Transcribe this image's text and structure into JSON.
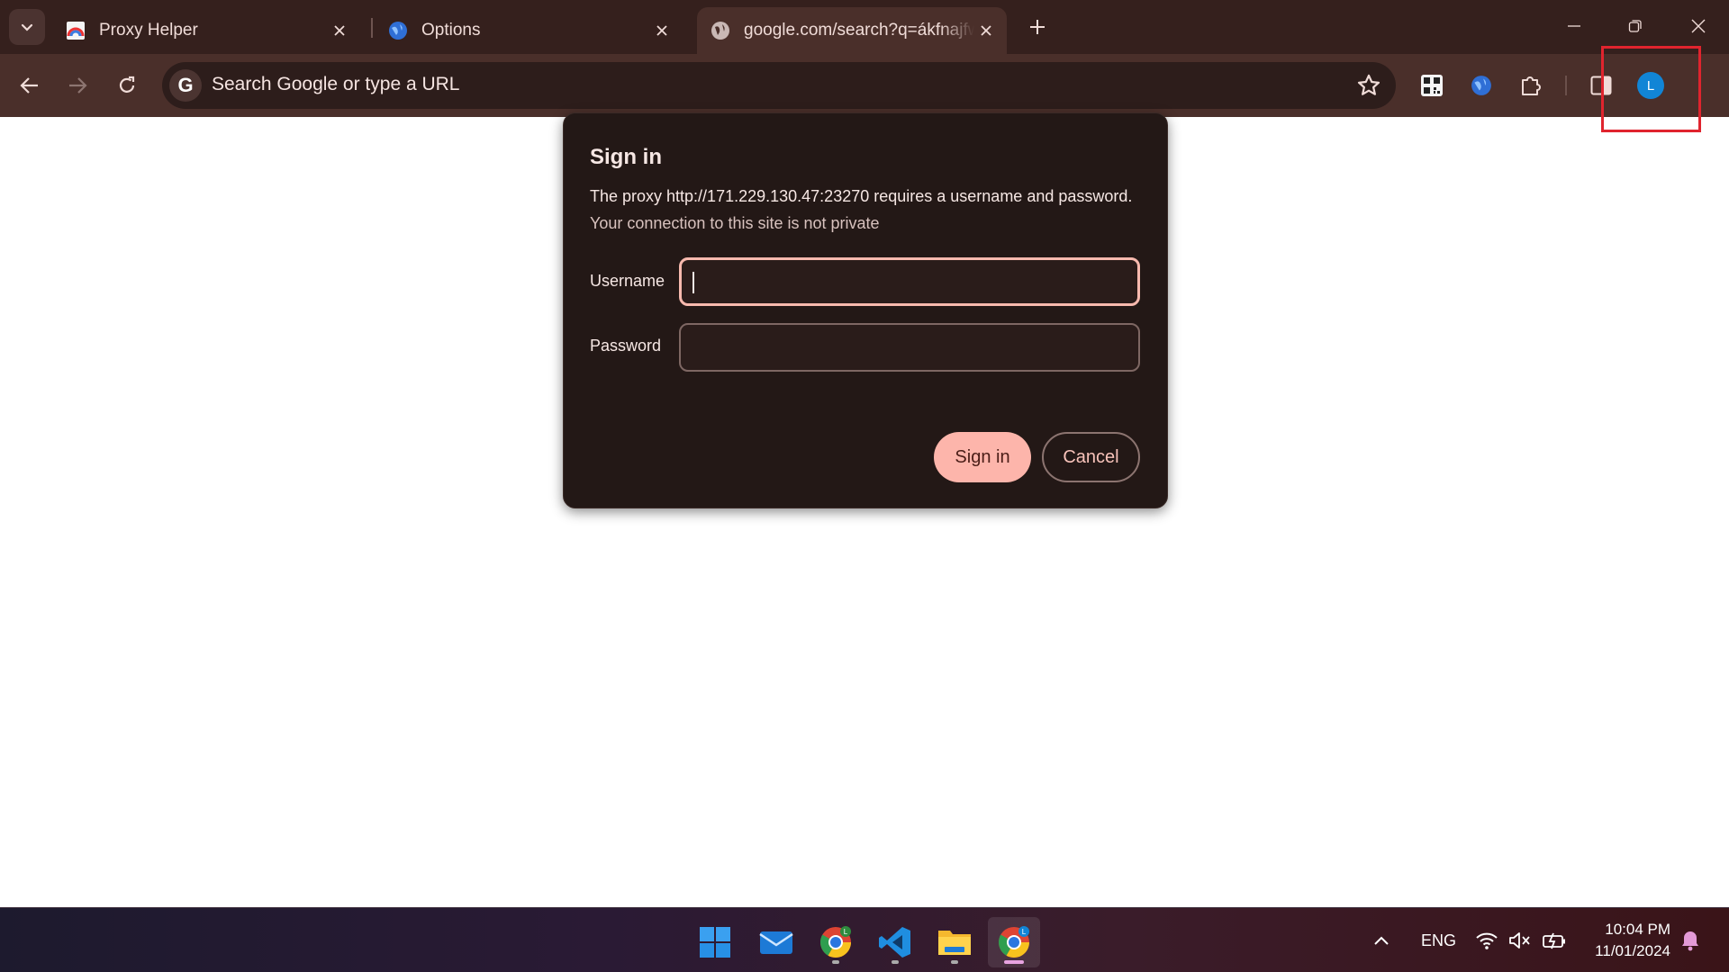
{
  "browser": {
    "tabs": [
      {
        "title": "Proxy Helper",
        "active": false,
        "favicon": "proxy-helper-icon"
      },
      {
        "title": "Options",
        "active": false,
        "favicon": "globe-icon"
      },
      {
        "title": "google.com/search?q=ákfnajfwqf",
        "active": true,
        "favicon": "globe-icon"
      }
    ],
    "omnibox": {
      "placeholder": "Search Google or type a URL",
      "provider_letter": "G"
    },
    "profile_initial": "L"
  },
  "dialog": {
    "title": "Sign in",
    "message": "The proxy http://171.229.130.47:23270 requires a username and password.",
    "subtext": "Your connection to this site is not private",
    "username_label": "Username",
    "username_value": "",
    "password_label": "Password",
    "password_value": "",
    "signin_label": "Sign in",
    "cancel_label": "Cancel"
  },
  "taskbar": {
    "apps": [
      {
        "name": "Start",
        "icon": "windows-icon"
      },
      {
        "name": "Mail",
        "icon": "mail-icon"
      },
      {
        "name": "Chrome",
        "icon": "chrome-icon",
        "badge": "L"
      },
      {
        "name": "Visual Studio Code",
        "icon": "vscode-icon"
      },
      {
        "name": "File Explorer",
        "icon": "folder-icon"
      },
      {
        "name": "Chrome",
        "icon": "chrome-icon",
        "badge": "L",
        "active": true
      }
    ],
    "language": "ENG",
    "time": "10:04 PM",
    "date": "11/01/2024"
  },
  "colors": {
    "titlebar": "#35201d",
    "toolbar": "#4a2f2a",
    "dialog_bg": "#231816",
    "accent": "#fdb5ab",
    "highlight_box": "#e0242e"
  }
}
